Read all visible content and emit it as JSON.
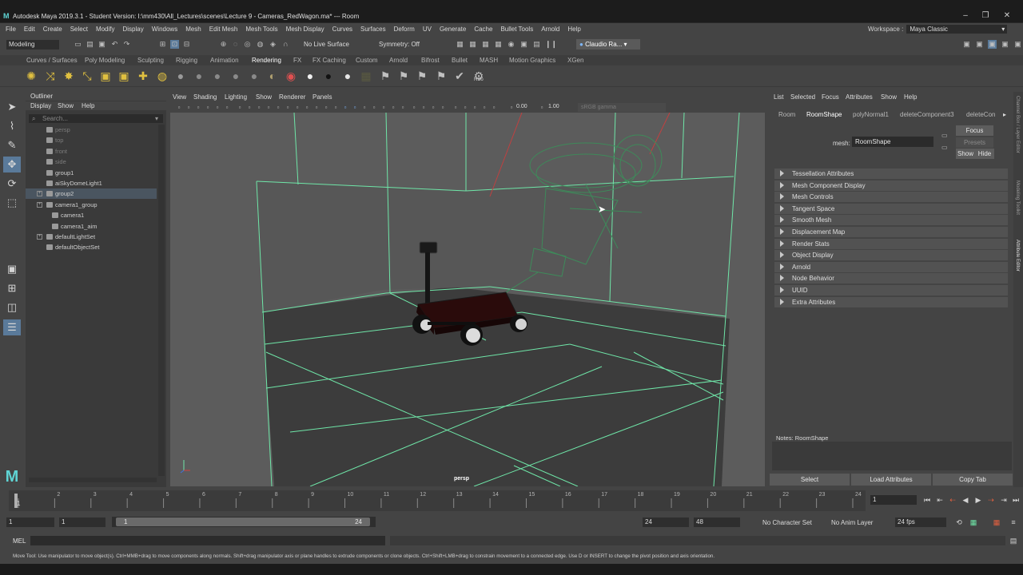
{
  "window": {
    "title": "Autodesk Maya 2019.3.1 - Student Version: I:\\mm430\\All_Lectures\\scenes\\Lecture 9 - Cameras_RedWagon.ma*   ---   Room",
    "minimize_icon": "minimize-icon",
    "maximize_icon": "restore-icon",
    "close_icon": "close-icon"
  },
  "menubar": [
    "File",
    "Edit",
    "Create",
    "Select",
    "Modify",
    "Display",
    "Windows",
    "Mesh",
    "Edit Mesh",
    "Mesh Tools",
    "Mesh Display",
    "Curves",
    "Surfaces",
    "Deform",
    "UV",
    "Generate",
    "Cache",
    "Bullet Tools",
    "Arnold",
    "Help"
  ],
  "workspace": {
    "label": "Workspace :",
    "value": "Maya Classic"
  },
  "statusline": {
    "menuset": "Modeling",
    "live_surface": "No Live Surface",
    "symmetry": "Symmetry: Off",
    "user": "Claudio Ra..."
  },
  "shelf_tabs": [
    "Curves / Surfaces",
    "Poly Modeling",
    "Sculpting",
    "Rigging",
    "Animation",
    "Rendering",
    "FX",
    "FX Caching",
    "Custom",
    "Arnold",
    "Bifrost",
    "Bullet",
    "MASH",
    "Motion Graphics",
    "XGen"
  ],
  "shelf_active_tab": "Rendering",
  "shelf_last_label": "RSo",
  "outliner": {
    "title": "Outliner",
    "menus": [
      "Display",
      "Show",
      "Help"
    ],
    "search_placeholder": "Search...",
    "items": [
      {
        "label": "persp",
        "dim": true,
        "indent": 1
      },
      {
        "label": "top",
        "dim": true,
        "indent": 1
      },
      {
        "label": "front",
        "dim": true,
        "indent": 1
      },
      {
        "label": "side",
        "dim": true,
        "indent": 1
      },
      {
        "label": "group1",
        "dim": false,
        "indent": 1
      },
      {
        "label": "aiSkyDomeLight1",
        "dim": false,
        "indent": 1
      },
      {
        "label": "group2",
        "dim": false,
        "indent": 1,
        "selected": true,
        "expand": true
      },
      {
        "label": "camera1_group",
        "dim": false,
        "indent": 1,
        "expand": true
      },
      {
        "label": "camera1",
        "dim": false,
        "indent": 2
      },
      {
        "label": "camera1_aim",
        "dim": false,
        "indent": 2
      },
      {
        "label": "defaultLightSet",
        "dim": false,
        "indent": 1,
        "expand": true
      },
      {
        "label": "defaultObjectSet",
        "dim": false,
        "indent": 1
      }
    ]
  },
  "viewport": {
    "menus": [
      "View",
      "Shading",
      "Lighting",
      "Show",
      "Renderer",
      "Panels"
    ],
    "exposure": "0.00",
    "gamma": "1.00",
    "color_space": "sRGB gamma",
    "camera_label": "persp"
  },
  "attribute_editor": {
    "menus": [
      "List",
      "Selected",
      "Focus",
      "Attributes",
      "Show",
      "Help"
    ],
    "tabs": [
      "Room",
      "RoomShape",
      "polyNormal1",
      "deleteComponent3",
      "deleteCon"
    ],
    "active_tab": "RoomShape",
    "mesh_label": "mesh:",
    "mesh_value": "RoomShape",
    "focus_btn": "Focus",
    "presets_btn": "Presets",
    "show_btn": "Show",
    "hide_btn": "Hide",
    "sections": [
      "Tessellation Attributes",
      "Mesh Component Display",
      "Mesh Controls",
      "Tangent Space",
      "Smooth Mesh",
      "Displacement Map",
      "Render Stats",
      "Object Display",
      "Arnold",
      "Node Behavior",
      "UUID",
      "Extra Attributes"
    ],
    "notes": "Notes:  RoomShape",
    "bottom_buttons": [
      "Select",
      "Load Attributes",
      "Copy Tab"
    ]
  },
  "side_tabs": [
    "Channel Box / Layer Editor",
    "Modeling Toolkit",
    "Attribute Editor"
  ],
  "timeline": {
    "ticks": [
      "1",
      "2",
      "3",
      "4",
      "5",
      "6",
      "7",
      "8",
      "9",
      "10",
      "11",
      "12",
      "13",
      "14",
      "15",
      "16",
      "17",
      "18",
      "19",
      "20",
      "21",
      "22",
      "23",
      "24"
    ],
    "current": "1"
  },
  "range": {
    "start": "1",
    "start_inner": "1",
    "handle_start": "1",
    "handle_end": "24",
    "end_inner": "24",
    "end": "48",
    "character_set": "No Character Set",
    "anim_layer": "No Anim Layer",
    "fps": "24 fps"
  },
  "cmdline": {
    "label": "MEL"
  },
  "helpline": "Move Tool: Use manipulator to move object(s). Ctrl+MMB+drag to move components along normals. Shift+drag manipulator axis or plane handles to extrude components or clone objects. Ctrl+Shift+LMB+drag to constrain movement to a connected edge. Use D or INSERT to change the pivot position and axis orientation.",
  "colors": {
    "accent": "#5fd4d4",
    "wire": "#6fe6a8",
    "selection": "#4a5560"
  }
}
